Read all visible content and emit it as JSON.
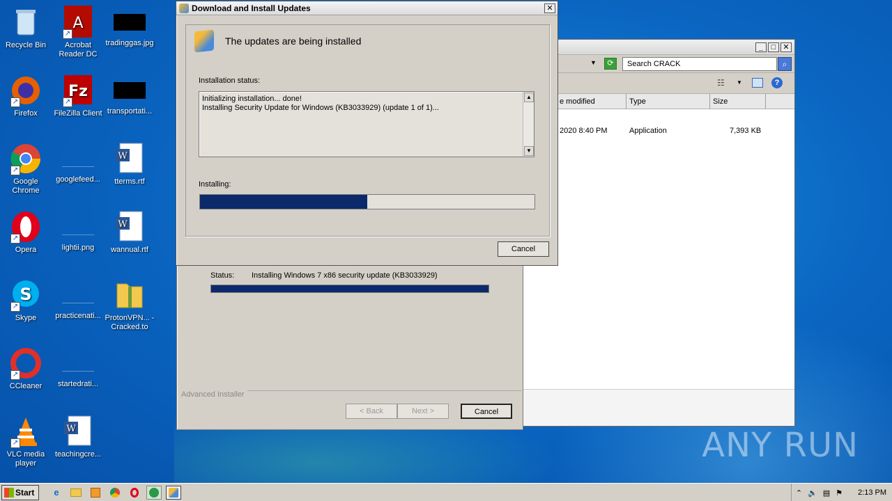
{
  "desktop": {
    "icons": [
      {
        "label": "Recycle Bin"
      },
      {
        "label": "Acrobat Reader DC"
      },
      {
        "label": "tradinggas.jpg"
      },
      {
        "label": "Firefox"
      },
      {
        "label": "FileZilla Client"
      },
      {
        "label": "transportati..."
      },
      {
        "label": "Google Chrome"
      },
      {
        "label": "googlefeed..."
      },
      {
        "label": "tterms.rtf"
      },
      {
        "label": "Opera"
      },
      {
        "label": "lightii.png"
      },
      {
        "label": "wannual.rtf"
      },
      {
        "label": "Skype"
      },
      {
        "label": "practicenati..."
      },
      {
        "label": "ProtonVPN... - Cracked.to"
      },
      {
        "label": "CCleaner"
      },
      {
        "label": "startedrati..."
      },
      {
        "label": "VLC media player"
      },
      {
        "label": "teachingcre..."
      }
    ]
  },
  "explorer": {
    "search_placeholder": "Search CRACK",
    "columns": {
      "modified": "e modified",
      "type": "Type",
      "size": "Size"
    },
    "row": {
      "modified": "2020 8:40 PM",
      "type": "Application",
      "size": "7,393 KB"
    }
  },
  "installer": {
    "status_label": "Status:",
    "status_text": "Installing Windows 7 x86 security update (KB3033929)",
    "progress": 1.0,
    "brand": "Advanced Installer",
    "back": "< Back",
    "next": "Next >",
    "cancel": "Cancel"
  },
  "dialog": {
    "title": "Download and Install Updates",
    "heading": "The updates are being installed",
    "installation_status_label": "Installation status:",
    "log_line1": "Initializing installation... done!",
    "log_line2": "Installing Security Update for Windows (KB3033929) (update 1 of 1)...",
    "installing_label": "Installing:",
    "progress": 0.5,
    "cancel": "Cancel",
    "close": "✕"
  },
  "taskbar": {
    "start": "Start",
    "clock": "2:13 PM"
  },
  "watermark": "ANY RUN",
  "colors": {
    "progress_fill": "#0c2a6b",
    "dialog_bg": "#d4d0c8"
  }
}
